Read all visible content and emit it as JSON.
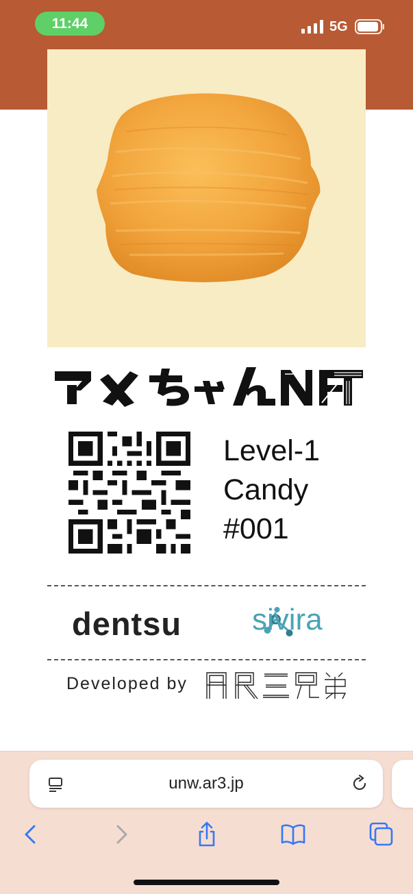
{
  "status_bar": {
    "time": "11:44",
    "network": "5G"
  },
  "card": {
    "logo_text": "アメちゃんNFT",
    "info_lines": [
      "Level-1",
      "Candy",
      "#001"
    ],
    "sponsor_left": "dentsu",
    "sponsor_right": "sivira",
    "developed_by": "Developed by",
    "developer_logo_text": "AR三兄弟"
  },
  "browser": {
    "url": "unw.ar3.jp",
    "icons": [
      "tab-overview-icon",
      "reload-icon",
      "back-icon",
      "forward-icon",
      "share-icon",
      "bookmarks-icon",
      "tabs-icon"
    ]
  },
  "colors": {
    "header": "#b85a33",
    "time_pill": "#5fd067",
    "card_bg": "#f8ecc4",
    "candy": "#f0a43a",
    "sivira": "#4aa3b4",
    "browser_bg": "#f6ddd2",
    "ios_blue": "#3478f6"
  }
}
